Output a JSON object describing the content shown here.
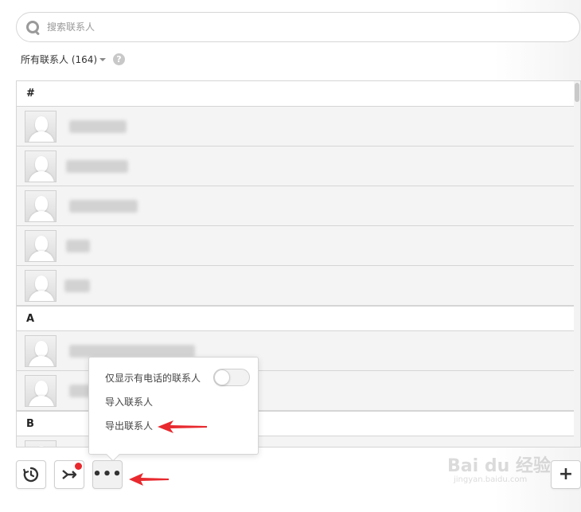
{
  "search": {
    "placeholder": "搜索联系人"
  },
  "filter": {
    "label": "所有联系人 (164)",
    "help": "?"
  },
  "sections": [
    "#",
    "A",
    "B"
  ],
  "popup": {
    "items": [
      "仅显示有电话的联系人",
      "导入联系人",
      "导出联系人"
    ],
    "toggle_on": false
  },
  "toolbar": {
    "more": "•••",
    "add": "+"
  },
  "watermark": {
    "brand": "Bai du 经验",
    "url": "jingyan.baidu.com"
  },
  "colors": {
    "badge": "#e8292e",
    "arrow": "#e8292e",
    "border": "#d5d5d5",
    "row_bg": "#f4f4f4"
  }
}
